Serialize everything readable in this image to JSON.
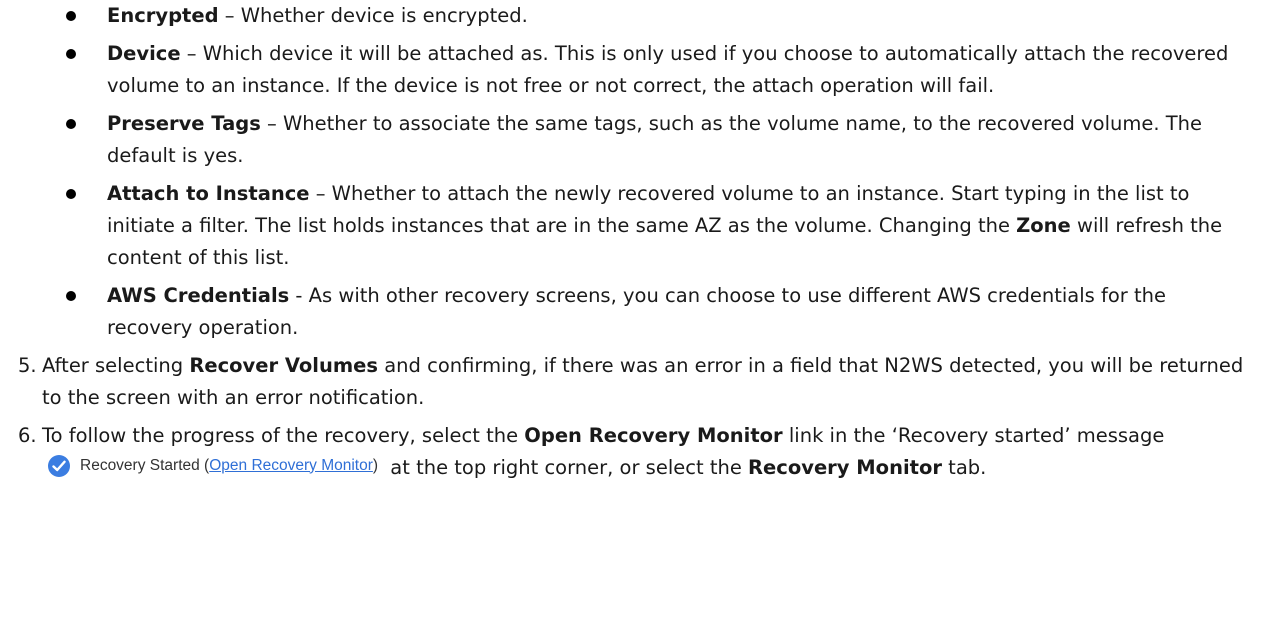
{
  "bullets": [
    {
      "term": "Encrypted",
      "text": " – Whether device is encrypted."
    },
    {
      "term": "Device",
      "text": " – Which device it will be attached as. This is only used if you choose to automatically attach the recovered volume to an instance. If the device is not free or not correct, the attach operation will fail."
    },
    {
      "term": "Preserve Tags",
      "text": " – Whether to associate the same tags, such as the volume name, to the recovered volume. The default is yes."
    },
    {
      "term": "Attach to Instance",
      "text_a": " – Whether to attach the newly recovered volume to an instance. Start typing in the list to initiate a filter. The list holds instances that are in the same AZ as the volume. Changing the ",
      "zone": "Zone",
      "text_b": " will refresh the content of this list."
    },
    {
      "term": "AWS Credentials",
      "text": " - As with other recovery screens, you can choose to use different AWS credentials for the recovery operation."
    }
  ],
  "steps": [
    {
      "num": "5.",
      "pre": "After selecting ",
      "strong": "Recover Volumes",
      "post": " and confirming, if there was an error in a field that N2WS detected, you will be returned to the screen with an error notification."
    },
    {
      "num": "6.",
      "pre": "To follow the progress of the recovery, select the ",
      "strong1": "Open Recovery Monitor",
      "mid1": " link in the ‘Recovery started’ message",
      "badge_text": "Recovery Started (",
      "badge_link": "Open Recovery Monitor",
      "badge_close": ")",
      "mid2": " at the top right corner, or select the ",
      "strong2": "Recovery Monitor",
      "post": " tab."
    }
  ],
  "colors": {
    "check_badge": "#3b7de1",
    "link": "#2f6fd6"
  },
  "icons": {
    "badge_icon": "check-circle-icon"
  }
}
